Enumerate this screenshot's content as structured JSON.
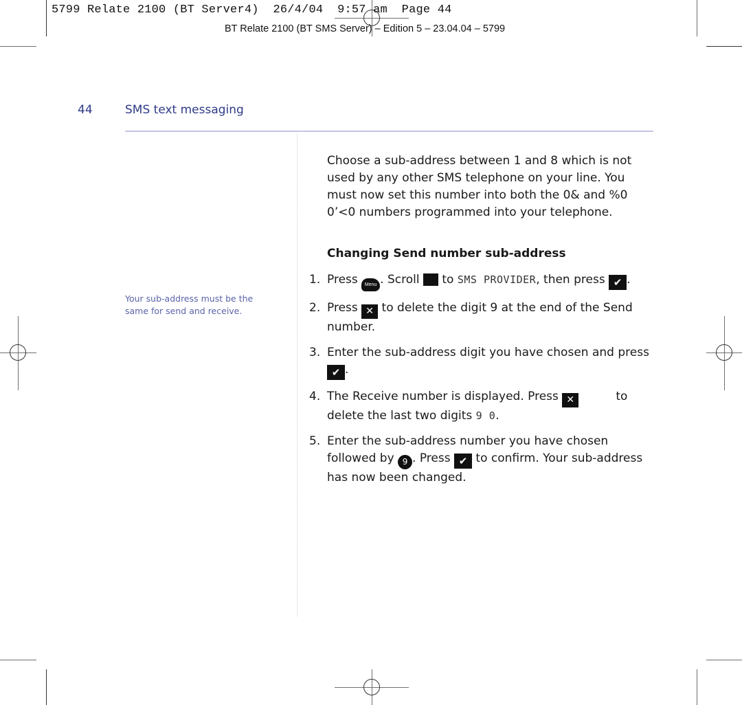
{
  "print_slug": {
    "job_line": "5799 Relate 2100 (BT Server4)  26/4/04  9:57 am  Page 44",
    "edition_line": "BT Relate 2100 (BT SMS Server) – Edition 5 – 23.04.04 – 5799"
  },
  "header": {
    "page_number": "44",
    "section_title": "SMS text messaging"
  },
  "sidebar": {
    "note": "Your sub-address must be the same for send and receive."
  },
  "main": {
    "intro": "Choose a sub-address between 1 and 8 which is not used by any other SMS telephone on your line. You must now set this number into both the  0&     and %0 0’<0 numbers programmed into your telephone.",
    "heading": "Changing Send number sub-address",
    "steps": [
      {
        "num": "1.",
        "t1": "Press ",
        "key_menu": "Menu",
        "t2": ". Scroll ",
        "t3": " to ",
        "lcd": "SMS PROVIDER",
        "t4": ", then press ",
        "t5": "."
      },
      {
        "num": "2.",
        "t1": "Press ",
        "t2": " to delete the digit 9 at the end of the Send number."
      },
      {
        "num": "3.",
        "t1": "Enter the sub-address digit you have chosen and press ",
        "t2": "."
      },
      {
        "num": "4.",
        "t1": "The Receive number is displayed. Press ",
        "t2": "          to delete the last two digits ",
        "lcd": "9 0",
        "t3": "."
      },
      {
        "num": "5.",
        "t1": "Enter the sub-address number you have chosen followed by ",
        "key_9": "9",
        "t2": ". Press ",
        "t3": " to confirm. Your sub-address has now been changed."
      }
    ]
  },
  "icons": {
    "ok": "✔",
    "delete": "✕"
  }
}
